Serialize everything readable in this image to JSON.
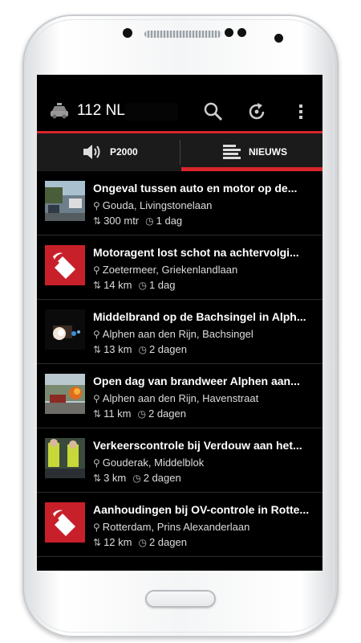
{
  "app": {
    "title": "112 NL"
  },
  "icons": {
    "logo": "police-car-icon",
    "search": "search-icon",
    "refresh": "refresh-icon",
    "overflow": "overflow-menu-icon"
  },
  "tabs": [
    {
      "label": "P2000",
      "icon": "speaker-icon",
      "selected": false
    },
    {
      "label": "NIEUWS",
      "icon": "news-list-icon",
      "selected": true
    }
  ],
  "colors": {
    "accent": "#d8262b",
    "background": "#000000",
    "tab_bar": "#1b1b1b"
  },
  "news": [
    {
      "title": "Ongeval tussen auto en motor op de...",
      "location": "Gouda, Livingstonelaan",
      "distance": "300 mtr",
      "time": "1 dag",
      "thumb": "photo"
    },
    {
      "title": "Motoragent lost schot na achtervolgi...",
      "location": "Zoetermeer, Griekenlandlaan",
      "distance": "14 km",
      "time": "1 dag",
      "thumb": "police-logo"
    },
    {
      "title": "Middelbrand op de Bachsingel in Alph...",
      "location": "Alphen aan den Rijn, Bachsingel",
      "distance": "13 km",
      "time": "2 dagen",
      "thumb": "photo"
    },
    {
      "title": "Open dag van brandweer Alphen aan...",
      "location": "Alphen aan den Rijn, Havenstraat",
      "distance": "11 km",
      "time": "2 dagen",
      "thumb": "photo"
    },
    {
      "title": "Verkeerscontrole bij Verdouw aan het...",
      "location": "Gouderak, Middelblok",
      "distance": "3 km",
      "time": "2 dagen",
      "thumb": "photo"
    },
    {
      "title": "Aanhoudingen bij OV-controle in Rotte...",
      "location": "Rotterdam, Prins Alexanderlaan",
      "distance": "12 km",
      "time": "2 dagen",
      "thumb": "police-logo"
    }
  ]
}
